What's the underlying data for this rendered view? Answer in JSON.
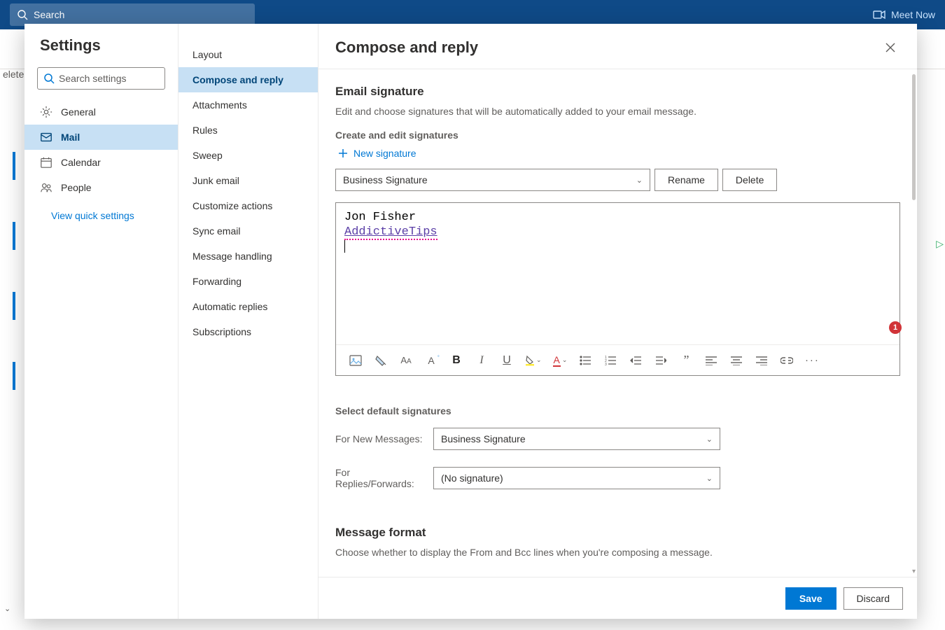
{
  "topbar": {
    "search_placeholder": "Search",
    "meet_now": "Meet Now"
  },
  "background": {
    "truncated_word": "elete"
  },
  "settings": {
    "title": "Settings",
    "search_placeholder": "Search settings",
    "nav": {
      "general": "General",
      "mail": "Mail",
      "calendar": "Calendar",
      "people": "People"
    },
    "quick_link": "View quick settings"
  },
  "sub": {
    "layout": "Layout",
    "compose": "Compose and reply",
    "attachments": "Attachments",
    "rules": "Rules",
    "sweep": "Sweep",
    "junk": "Junk email",
    "customize": "Customize actions",
    "sync": "Sync email",
    "msghandling": "Message handling",
    "forwarding": "Forwarding",
    "autoreply": "Automatic replies",
    "subscriptions": "Subscriptions"
  },
  "panel": {
    "title": "Compose and reply",
    "sig_heading": "Email signature",
    "sig_desc": "Edit and choose signatures that will be automatically added to your email message.",
    "create_label": "Create and edit signatures",
    "new_sig": "New signature",
    "selected_sig": "Business Signature",
    "rename": "Rename",
    "delete": "Delete",
    "sig_line1": "Jon Fisher",
    "sig_line2": "AddictiveTips",
    "badge": "1",
    "default_heading": "Select default signatures",
    "new_msg_label": "For New Messages:",
    "new_msg_value": "Business Signature",
    "reply_label": "For Replies/Forwards:",
    "reply_value": "(No signature)",
    "msgfmt_heading": "Message format",
    "msgfmt_desc": "Choose whether to display the From and Bcc lines when you're composing a message.",
    "save": "Save",
    "discard": "Discard"
  },
  "toolbar_icons": {
    "image": "image-icon",
    "format_painter": "format-painter-icon",
    "font_family": "font-family-icon",
    "font_size": "font-size-icon",
    "bold": "B",
    "italic": "I",
    "underline": "U",
    "highlight": "highlight-icon",
    "font_color": "font-color-icon",
    "bullets": "bullets-icon",
    "numbered": "numbered-icon",
    "outdent": "outdent-icon",
    "indent": "indent-icon",
    "quote": "quote-icon",
    "align_left": "align-left-icon",
    "align_center": "align-center-icon",
    "align_right": "align-right-icon",
    "link": "link-icon",
    "more": "more-icon"
  }
}
